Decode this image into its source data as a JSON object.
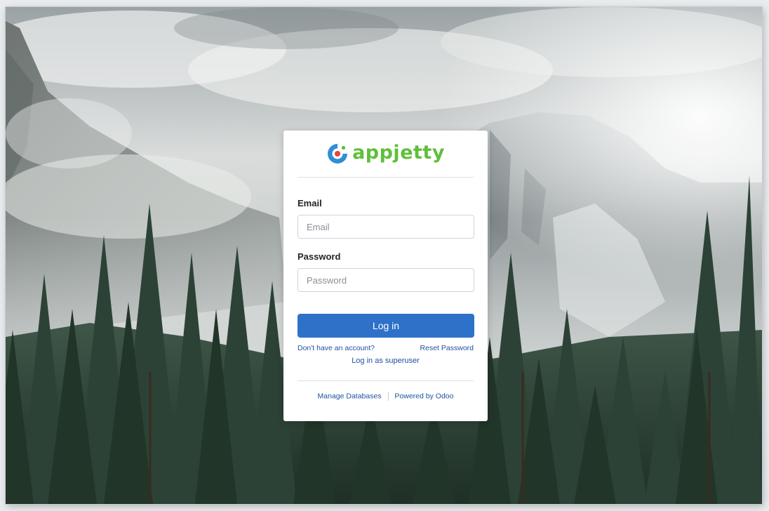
{
  "brand": {
    "name": "appjetty",
    "icon": "appjetty-logo-icon",
    "color": "#5fbf3a"
  },
  "form": {
    "email_label": "Email",
    "email_placeholder": "Email",
    "email_value": "",
    "password_label": "Password",
    "password_placeholder": "Password",
    "password_value": "",
    "submit_label": "Log in"
  },
  "links": {
    "signup": "Don't have an account?",
    "reset": "Reset Password",
    "superuser": "Log in as superuser"
  },
  "footer": {
    "manage": "Manage Databases",
    "powered": "Powered by Odoo"
  },
  "colors": {
    "primary_button": "#2e71c9",
    "link": "#1f4f9e"
  }
}
